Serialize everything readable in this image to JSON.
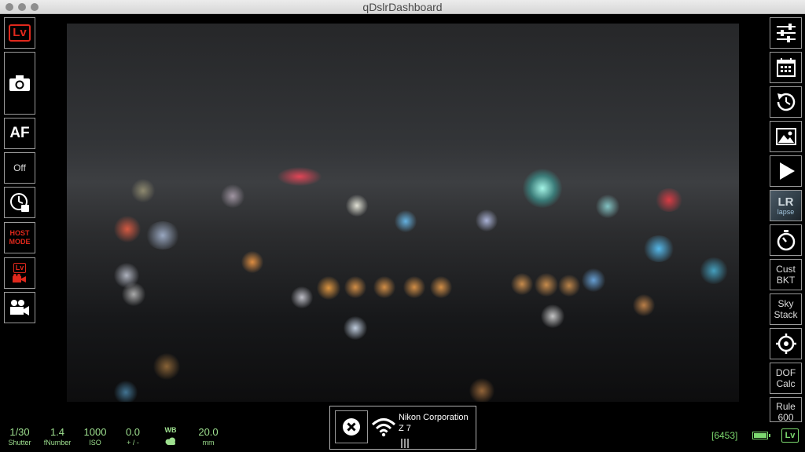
{
  "window": {
    "title": "qDslrDashboard"
  },
  "left_toolbar": {
    "liveview_label": "Lv",
    "af_label": "AF",
    "af_mode_value": "Off",
    "host_mode_label": "HOST\nMODE",
    "movie_liveview_label": "Lv"
  },
  "right_toolbar": {
    "lrt_label": "LR",
    "lrt_sub_label": "lapse",
    "cust_bkt_label": "Cust\nBKT",
    "sky_stack_label": "Sky\nStack",
    "dof_calc_label": "DOF\nCalc",
    "rule600_label": "Rule\n600"
  },
  "status_bar": {
    "shutter": {
      "value": "1/30",
      "label": "Shutter"
    },
    "fnumber": {
      "value": "1.4",
      "label": "fNumber"
    },
    "iso": {
      "value": "1000",
      "label": "ISO"
    },
    "ev": {
      "value": "0.0",
      "label": "+ / -"
    },
    "wb": {
      "label": "WB",
      "icon": "cloudy-icon"
    },
    "focal": {
      "value": "20.0",
      "label": "mm"
    },
    "shots_remaining": "[6453]",
    "battery_level": 1.0,
    "liveview_badge": "Lv"
  },
  "camera_panel": {
    "manufacturer": "Nikon Corporation",
    "model": "Z 7"
  },
  "colors": {
    "accent_green": "#9ee08f",
    "accent_red": "#e0281c",
    "border_gray": "#9a9a9a"
  }
}
